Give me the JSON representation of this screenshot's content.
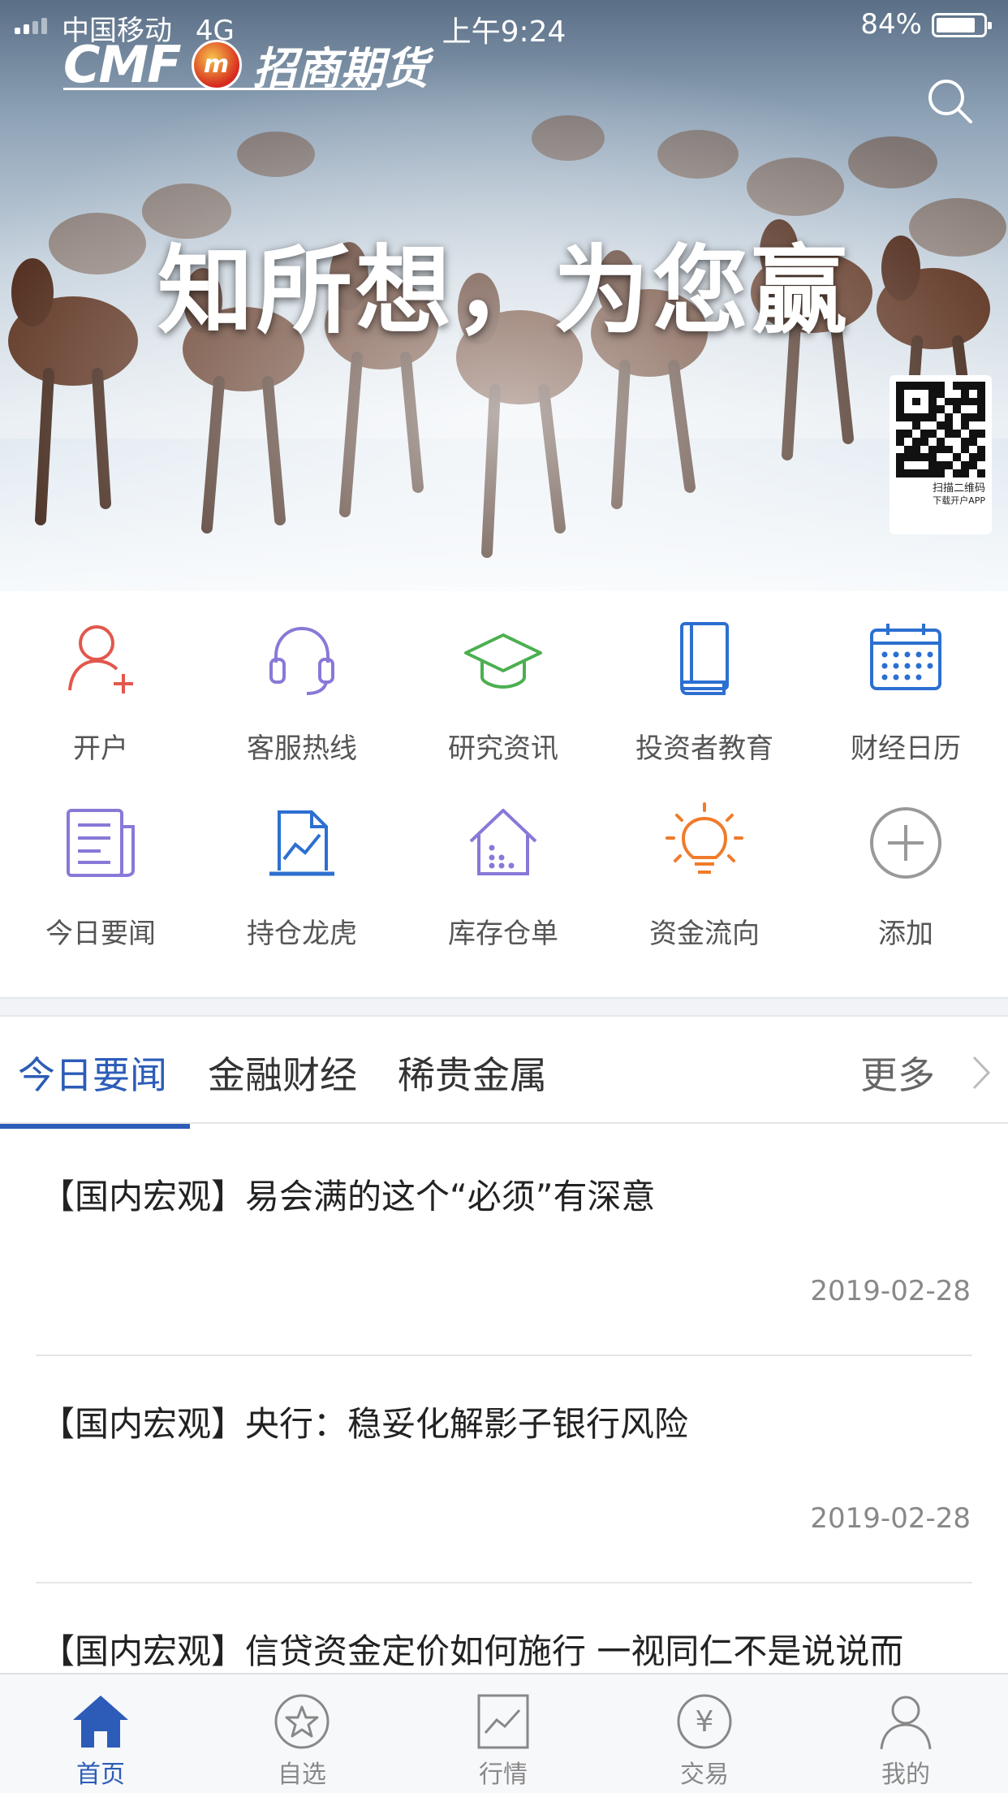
{
  "status_bar": {
    "carrier": "中国移动",
    "network": "4G",
    "time": "上午9:24",
    "battery_percent": "84%",
    "battery_level": 0.84
  },
  "banner": {
    "logo_en": "CMF",
    "logo_badge": "m",
    "logo_cn": "招商期货",
    "slogan": "知所想，为您赢",
    "qr_caption_1": "扫描二维码",
    "qr_caption_2": "下载开户APP",
    "search_icon": "search-icon"
  },
  "quick_grid": [
    {
      "label": "开户",
      "icon": "user-plus-icon",
      "color": "#e2574c"
    },
    {
      "label": "客服热线",
      "icon": "headset-icon",
      "color": "#8a78d8"
    },
    {
      "label": "研究资讯",
      "icon": "graduation-cap-icon",
      "color": "#4caf50"
    },
    {
      "label": "投资者教育",
      "icon": "book-icon",
      "color": "#2c6fd1"
    },
    {
      "label": "财经日历",
      "icon": "calendar-icon",
      "color": "#2c6fd1"
    },
    {
      "label": "今日要闻",
      "icon": "news-icon",
      "color": "#8a78d8"
    },
    {
      "label": "持仓龙虎",
      "icon": "chart-document-icon",
      "color": "#2c6fd1"
    },
    {
      "label": "库存仓单",
      "icon": "warehouse-icon",
      "color": "#8a78d8"
    },
    {
      "label": "资金流向",
      "icon": "lightbulb-icon",
      "color": "#f07b2b"
    },
    {
      "label": "添加",
      "icon": "plus-circle-icon",
      "color": "#999999"
    }
  ],
  "tabs": {
    "items": [
      "今日要闻",
      "金融财经",
      "稀贵金属"
    ],
    "active_index": 0,
    "more_label": "更多"
  },
  "news": [
    {
      "title": "【国内宏观】易会满的这个“必须”有深意",
      "date": "2019-02-28"
    },
    {
      "title": "【国内宏观】央行：稳妥化解影子银行风险",
      "date": "2019-02-28"
    },
    {
      "title": "【国内宏观】信贷资金定价如何施行 一视同仁不是说说而",
      "date": ""
    }
  ],
  "bottom_nav": [
    {
      "label": "首页",
      "icon": "home-icon",
      "active": true
    },
    {
      "label": "自选",
      "icon": "star-circle-icon",
      "active": false
    },
    {
      "label": "行情",
      "icon": "market-chart-icon",
      "active": false
    },
    {
      "label": "交易",
      "icon": "yuan-circle-icon",
      "active": false
    },
    {
      "label": "我的",
      "icon": "person-icon",
      "active": false
    }
  ],
  "colors": {
    "accent": "#2c5cb8",
    "text": "#222222",
    "muted": "#888888"
  }
}
